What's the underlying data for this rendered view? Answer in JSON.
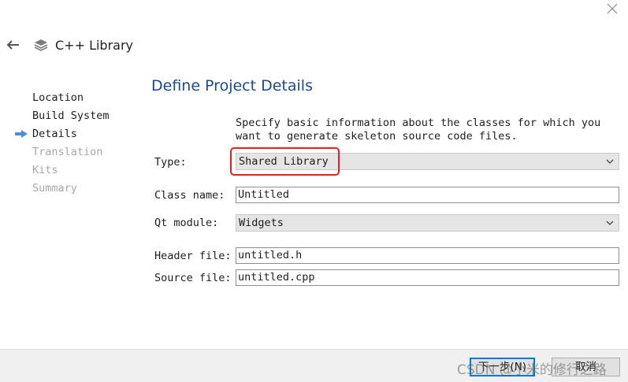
{
  "window": {
    "title": "C++ Library"
  },
  "steps": [
    {
      "label": "Location",
      "state": "done"
    },
    {
      "label": "Build System",
      "state": "done"
    },
    {
      "label": "Details",
      "state": "current"
    },
    {
      "label": "Translation",
      "state": "pending"
    },
    {
      "label": "Kits",
      "state": "pending"
    },
    {
      "label": "Summary",
      "state": "pending"
    }
  ],
  "page": {
    "heading": "Define Project Details",
    "description": "Specify basic information about the classes for which you want to generate skeleton source code files."
  },
  "form": {
    "type_label": "Type:",
    "type_value": "Shared Library",
    "class_name_label": "Class name:",
    "class_name_value": "Untitled",
    "qt_module_label": "Qt module:",
    "qt_module_value": "Widgets",
    "header_file_label": "Header file:",
    "header_file_value": "untitled.h",
    "source_file_label": "Source file:",
    "source_file_value": "untitled.cpp"
  },
  "buttons": {
    "next": "下一步(N)",
    "cancel": "取消"
  },
  "watermark": "CSDN @小米的修行之路",
  "icons": {
    "close": "close-icon",
    "back": "back-arrow-icon",
    "library": "library-stack-icon",
    "current_step": "current-step-arrow-icon",
    "dropdown": "chevron-down-icon"
  },
  "colors": {
    "heading": "#1c4a8c",
    "step_arrow": "#4a8fd9",
    "highlight": "#e8201c",
    "default_button_border": "#0078d7"
  }
}
